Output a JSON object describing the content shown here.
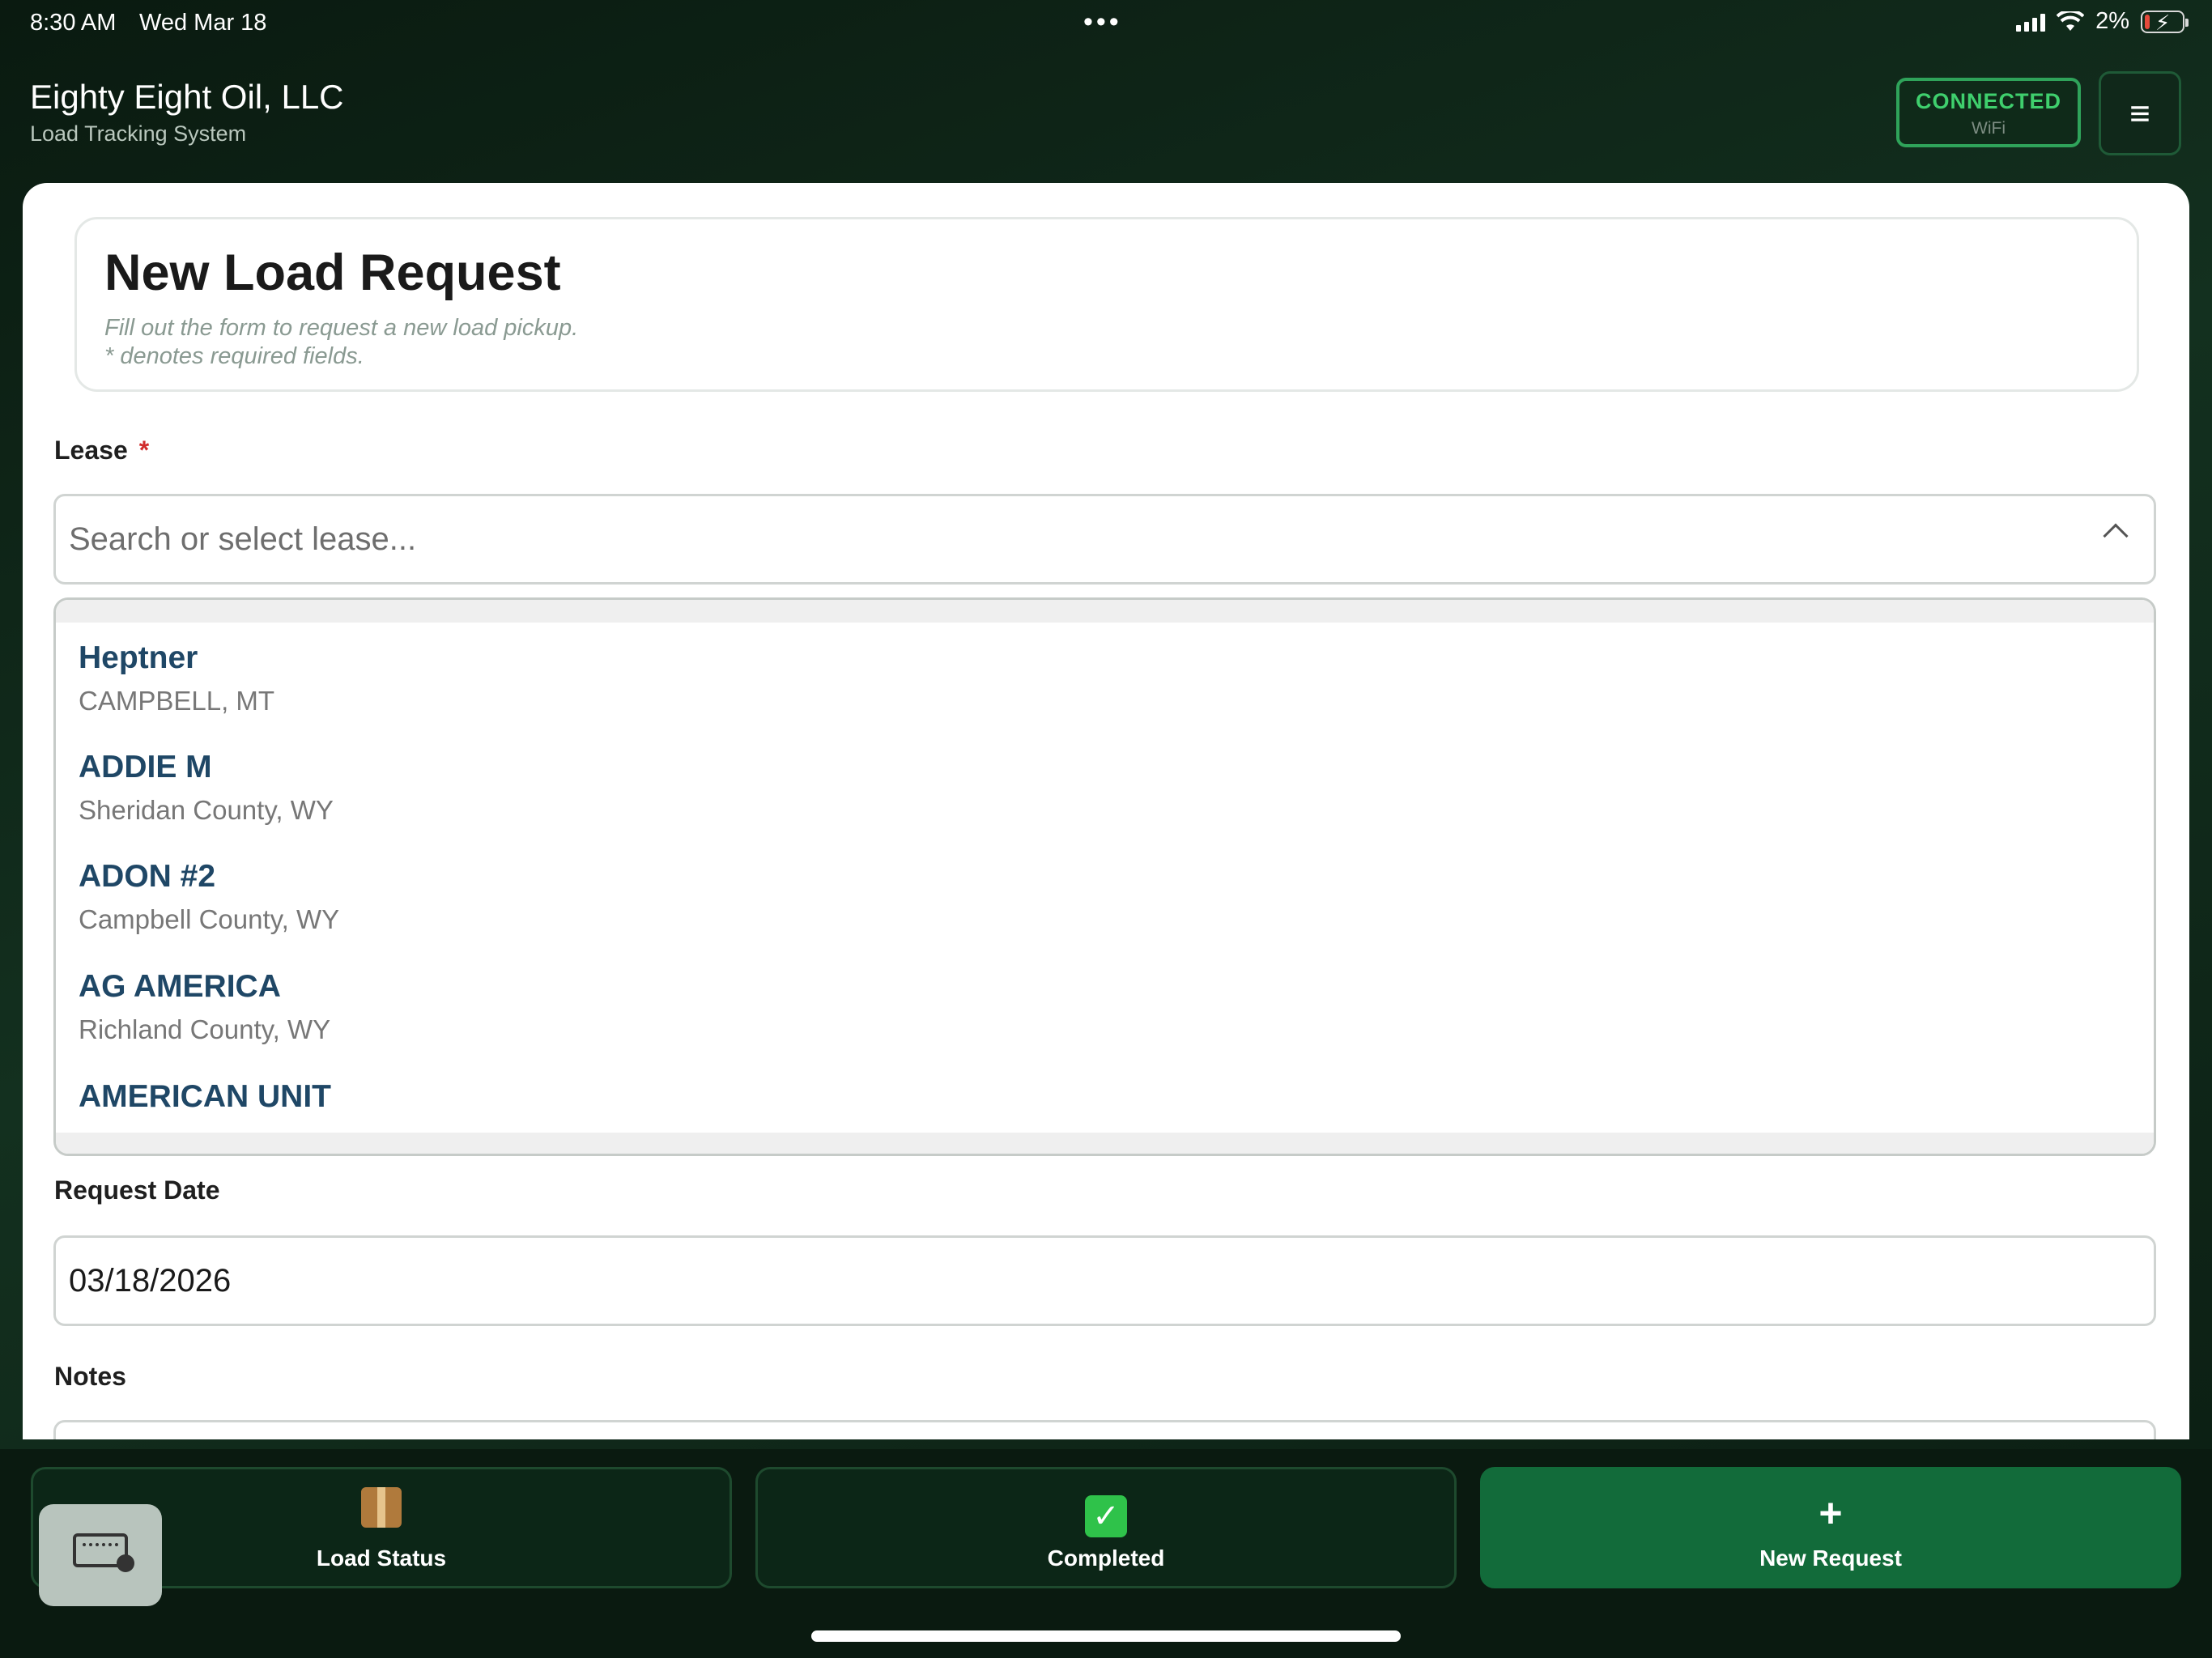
{
  "status_bar": {
    "time": "8:30 AM",
    "date": "Wed Mar 18",
    "dots": "•••",
    "battery_percent": "2%"
  },
  "header": {
    "title": "Eighty Eight Oil, LLC",
    "subtitle": "Load Tracking System",
    "connection": {
      "status": "CONNECTED",
      "type": "WiFi"
    },
    "menu_icon": "≡"
  },
  "form": {
    "title": "New Load Request",
    "help_line1": "Fill out the form to request a new load pickup.",
    "help_line2": "* denotes required fields.",
    "lease": {
      "label": "Lease",
      "required_mark": "*",
      "placeholder": "Search or select lease...",
      "options": [
        {
          "name": "Heptner",
          "location": "CAMPBELL, MT"
        },
        {
          "name": "ADDIE M",
          "location": "Sheridan County, WY"
        },
        {
          "name": "ADON #2",
          "location": "Campbell County, WY"
        },
        {
          "name": "AG AMERICA",
          "location": "Richland County, WY"
        },
        {
          "name": "AMERICAN UNIT",
          "location": ""
        }
      ]
    },
    "request_date": {
      "label": "Request Date",
      "value": "03/18/2026"
    },
    "notes": {
      "label": "Notes"
    }
  },
  "bottom_nav": {
    "load_status": "Load Status",
    "completed": "Completed",
    "completed_icon": "✓",
    "new_request": "New Request",
    "new_request_icon": "+"
  },
  "colors": {
    "accent": "#126b3a",
    "connected": "#3fcf6d",
    "lease_name": "#1f4766",
    "required": "#d12b2b"
  }
}
